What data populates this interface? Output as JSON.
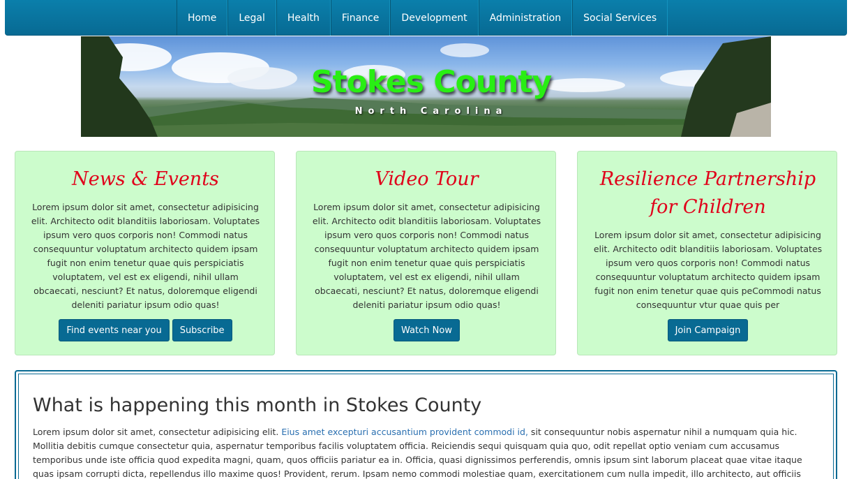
{
  "nav": {
    "items": [
      "Home",
      "Legal",
      "Health",
      "Finance",
      "Development",
      "Administration",
      "Social Services"
    ]
  },
  "banner": {
    "title": "Stokes County",
    "subtitle": "North Carolina"
  },
  "cards": [
    {
      "title": "News & Events",
      "text": "Lorem ipsum dolor sit amet, consectetur adipisicing elit. Architecto odit blanditiis laboriosam. Voluptates ipsum vero quos corporis non! Commodi natus consequuntur voluptatum architecto quidem ipsam fugit non enim tenetur quae quis perspiciatis voluptatem, vel est ex eligendi, nihil ullam obcaecati, nesciunt? Et natus, doloremque eligendi deleniti pariatur ipsum odio quas!",
      "buttons": [
        "Find events near you",
        "Subscribe"
      ]
    },
    {
      "title": "Video Tour",
      "text": "Lorem ipsum dolor sit amet, consectetur adipisicing elit. Architecto odit blanditiis laboriosam. Voluptates ipsum vero quos corporis non! Commodi natus consequuntur voluptatum architecto quidem ipsam fugit non enim tenetur quae quis perspiciatis voluptatem, vel est ex eligendi, nihil ullam obcaecati, nesciunt? Et natus, doloremque eligendi deleniti pariatur ipsum odio quas!",
      "buttons": [
        "Watch Now"
      ]
    },
    {
      "title": "Resilience Partnership for Children",
      "text": "Lorem ipsum dolor sit amet, consectetur adipisicing elit. Architecto odit blanditiis laboriosam. Voluptates ipsum vero quos corporis non! Commodi natus consequuntur voluptatum architecto quidem ipsam fugit non enim tenetur quae quis peCommodi natus consequuntur vtur quae quis per",
      "buttons": [
        "Join Campaign"
      ]
    }
  ],
  "month": {
    "title": "What is happening this month in Stokes County",
    "text_before": "Lorem ipsum dolor sit amet, consectetur adipisicing elit. ",
    "link": "Eius amet excepturi accusantium provident commodi id,",
    "text_after": " sit consequuntur nobis aspernatur nihil a numquam quia hic. Mollitia debitis cumque consectetur quia, aspernatur temporibus facilis voluptatem officia. Reiciendis sequi quisquam quia quo, odit repellat optio veniam cum accusamus temporibus unde iste officia quod expedita magni, quam, quos officiis pariatur ea in. Officia, quasi dignissimos perferendis, omnis ipsum sint laborum placeat quae vitae itaque quas ipsam corrupti dicta, repellendus illo maxime quos! Provident, rerum. Ipsam nemo commodi molestiae quam, exercitationem cum nulla impedit, illo architecto, aut officiis fuga repellat natus,"
  },
  "colors": {
    "nav_bg": "#086a93",
    "card_bg": "#ccfccc",
    "card_title": "#e0001a",
    "button_bg": "#086a93",
    "banner_title": "#29ee14",
    "link": "#2a6fb0"
  }
}
